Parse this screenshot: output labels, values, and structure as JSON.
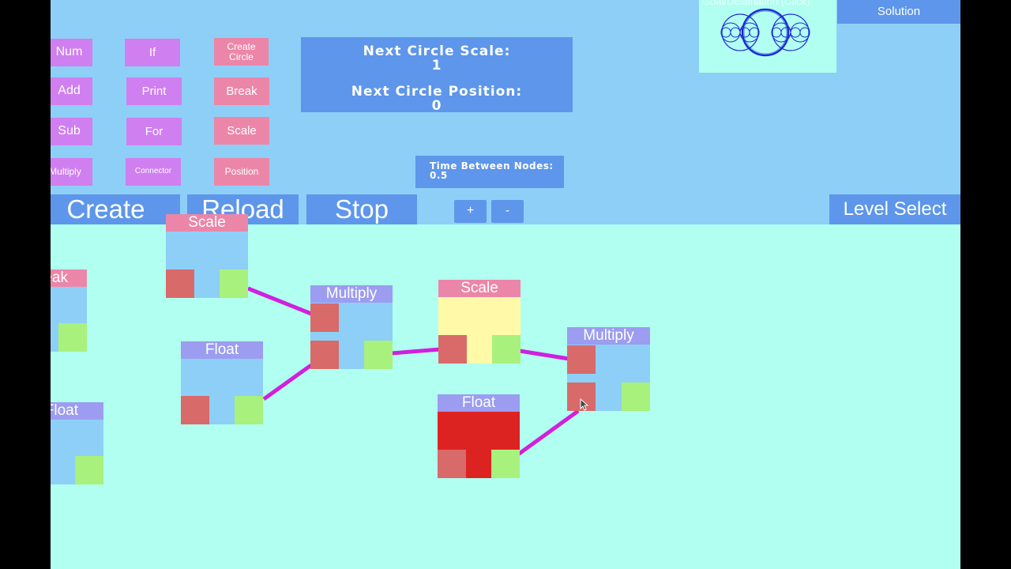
{
  "palette": {
    "col1": [
      "Num",
      "Add",
      "Sub",
      "Multiply"
    ],
    "col2": [
      "If",
      "Print",
      "For",
      "Connector"
    ],
    "col3": [
      "Create Circle",
      "Break",
      "Scale",
      "Position"
    ]
  },
  "info": {
    "scale_label": "Next Circle Scale:",
    "scale_value": "1",
    "position_label": "Next Circle Position:",
    "position_value": "0",
    "time_label": "Time Between Nodes: 0.5"
  },
  "goal": {
    "label": "Goal/Destination (Click)"
  },
  "toolbar": {
    "create": "Create",
    "reload": "Reload",
    "stop": "Stop",
    "plus": "+",
    "minus": "-",
    "level_select": "Level Select",
    "solution": "Solution"
  },
  "nodes": {
    "scale_top": "Scale",
    "break": "Break",
    "float_left": "Float",
    "float_mid": "Float",
    "multiply_1": "Multiply",
    "scale_mid": "Scale",
    "float_red": "Float",
    "multiply_2": "Multiply"
  },
  "colors": {
    "workspace": "#b1fff0",
    "toolbar": "#8ecff7",
    "button_blue": "#5d96ea",
    "palette_purple": "#cf7ff0",
    "palette_pink": "#ec86a8",
    "input_port": "#d86a6a",
    "output_port": "#a8f17c",
    "wire": "#d11fe0",
    "header_purple": "#9c9cf0",
    "header_pink": "#ec86a8",
    "selected_body": "#fff9a8",
    "red_body": "#dd2222"
  }
}
